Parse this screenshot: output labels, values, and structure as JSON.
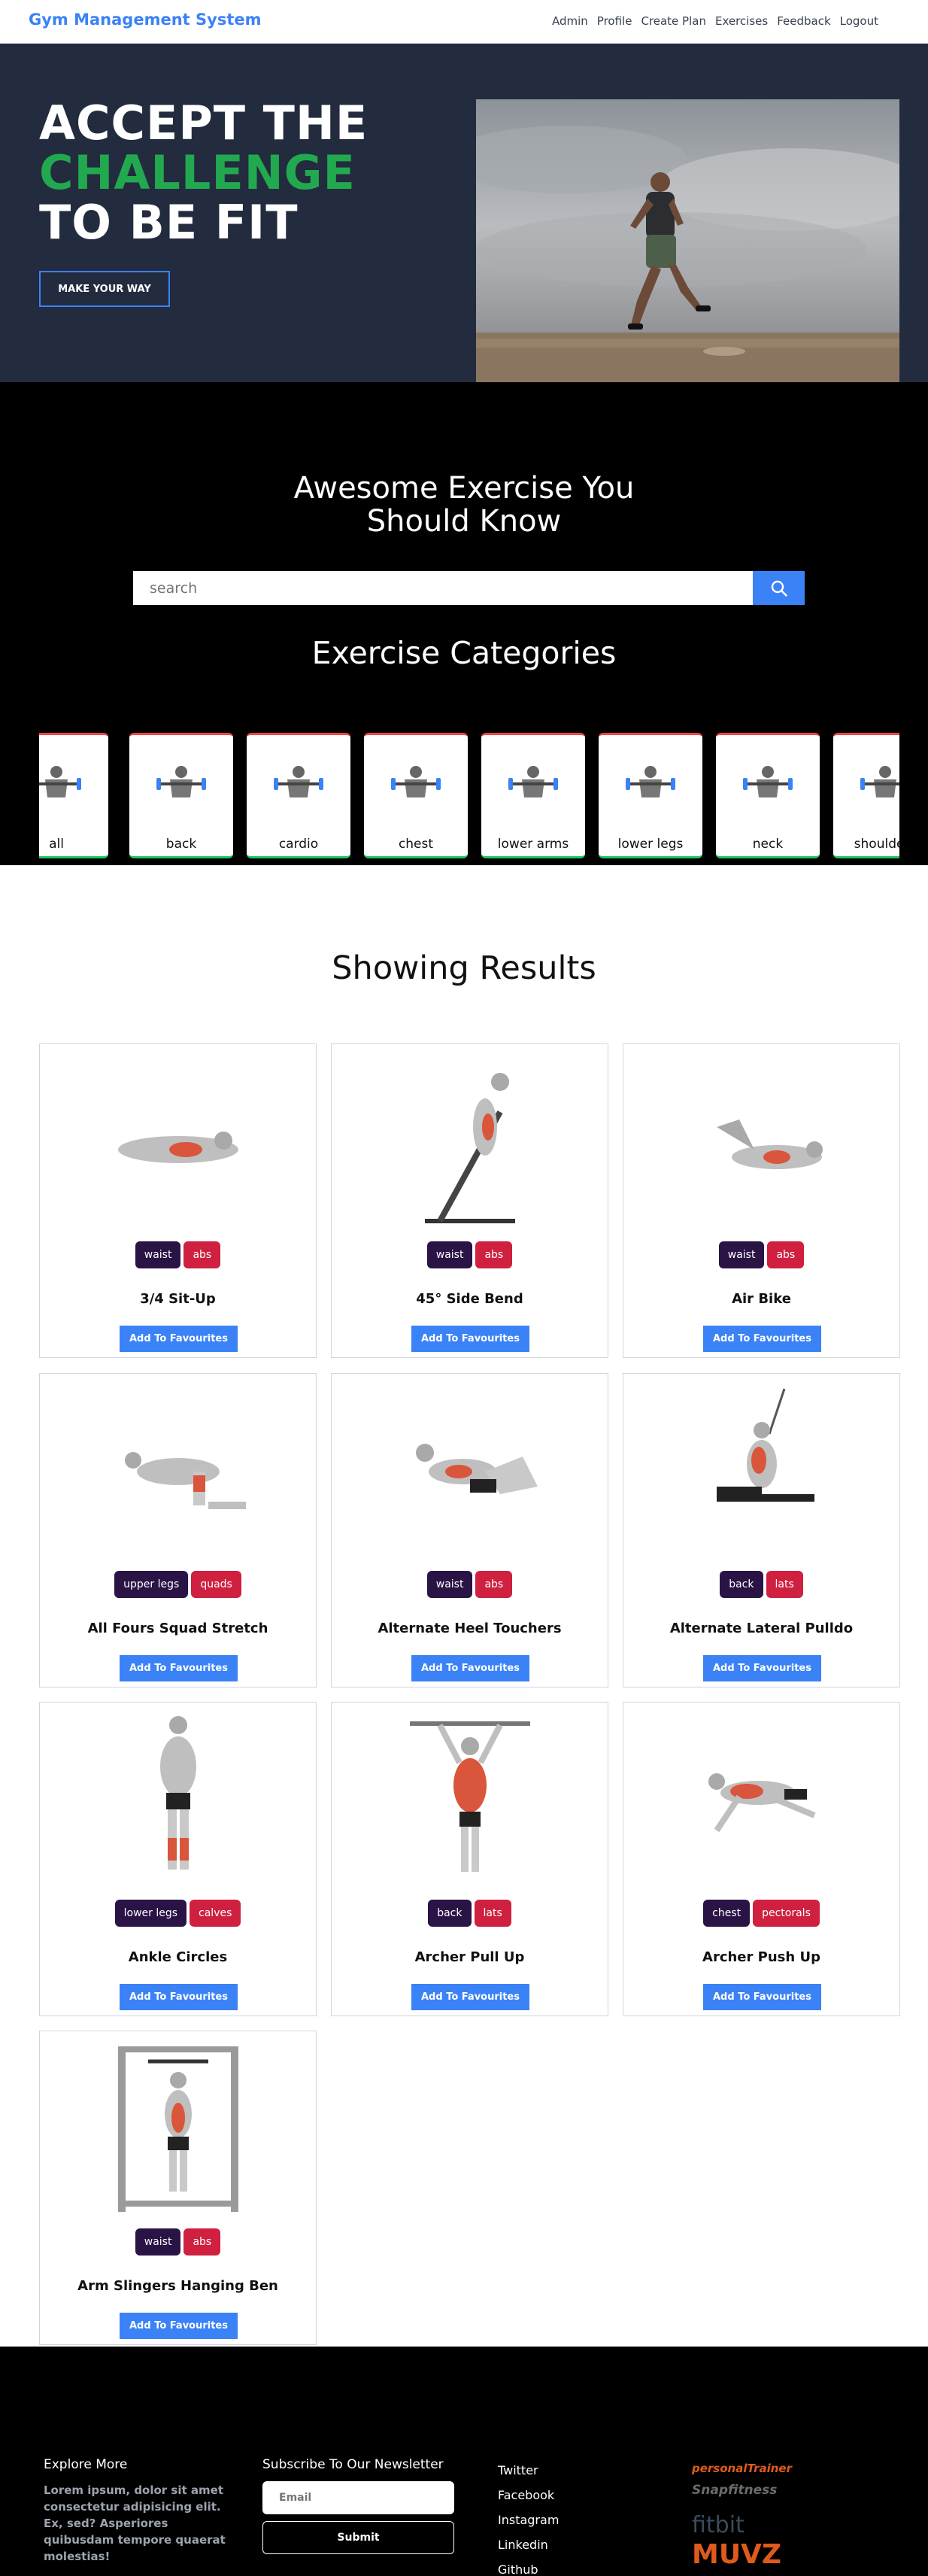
{
  "navbar": {
    "brand": "Gym Management System",
    "links": [
      "Admin",
      "Profile",
      "Create Plan",
      "Exercises",
      "Feedback",
      "Logout"
    ]
  },
  "hero": {
    "line1": "ACCEPT THE",
    "line2": "CHALLENGE",
    "line3": "TO BE FIT",
    "button": "MAKE YOUR WAY",
    "colors": {
      "background": "#232b3e",
      "accent": "#22a94f",
      "button_border": "#3b82f6"
    }
  },
  "exercise_section": {
    "title_line1": "Awesome Exercise You",
    "title_line2": "Should Know",
    "search_placeholder": "search",
    "categories_title": "Exercise Categories",
    "categories": [
      "all",
      "back",
      "cardio",
      "chest",
      "lower arms",
      "lower legs",
      "neck",
      "shoulders"
    ]
  },
  "results": {
    "title": "Showing Results",
    "button_label": "Add To Favourites",
    "cards": [
      {
        "name": "3/4 Sit-Up",
        "tags": [
          "waist",
          "abs"
        ]
      },
      {
        "name": "45° Side Bend",
        "tags": [
          "waist",
          "abs"
        ]
      },
      {
        "name": "Air Bike",
        "tags": [
          "waist",
          "abs"
        ]
      },
      {
        "name": "All Fours Squad Stretch",
        "tags": [
          "upper legs",
          "quads"
        ]
      },
      {
        "name": "Alternate Heel Touchers",
        "tags": [
          "waist",
          "abs"
        ]
      },
      {
        "name": "Alternate Lateral Pulldo",
        "tags": [
          "back",
          "lats"
        ]
      },
      {
        "name": "Ankle Circles",
        "tags": [
          "lower legs",
          "calves"
        ]
      },
      {
        "name": "Archer Pull Up",
        "tags": [
          "back",
          "lats"
        ]
      },
      {
        "name": "Archer Push Up",
        "tags": [
          "chest",
          "pectorals"
        ]
      },
      {
        "name": "Arm Slingers Hanging Ben",
        "tags": [
          "waist",
          "abs"
        ]
      }
    ]
  },
  "footer": {
    "explore_title": "Explore More",
    "lorem": "Lorem ipsum, dolor sit amet consectetur adipisicing elit. Ex, sed? Asperiores quibusdam tempore quaerat molestias!",
    "newsletter_title": "Subscribe To Our Newsletter",
    "email_placeholder": "Email",
    "submit": "Submit",
    "links": [
      "Twitter",
      "Facebook",
      "Instagram",
      "Linkedin",
      "Github"
    ],
    "logos": [
      "personalTrainer",
      "Snapfitness",
      "fitbit",
      "MUVZ"
    ]
  }
}
